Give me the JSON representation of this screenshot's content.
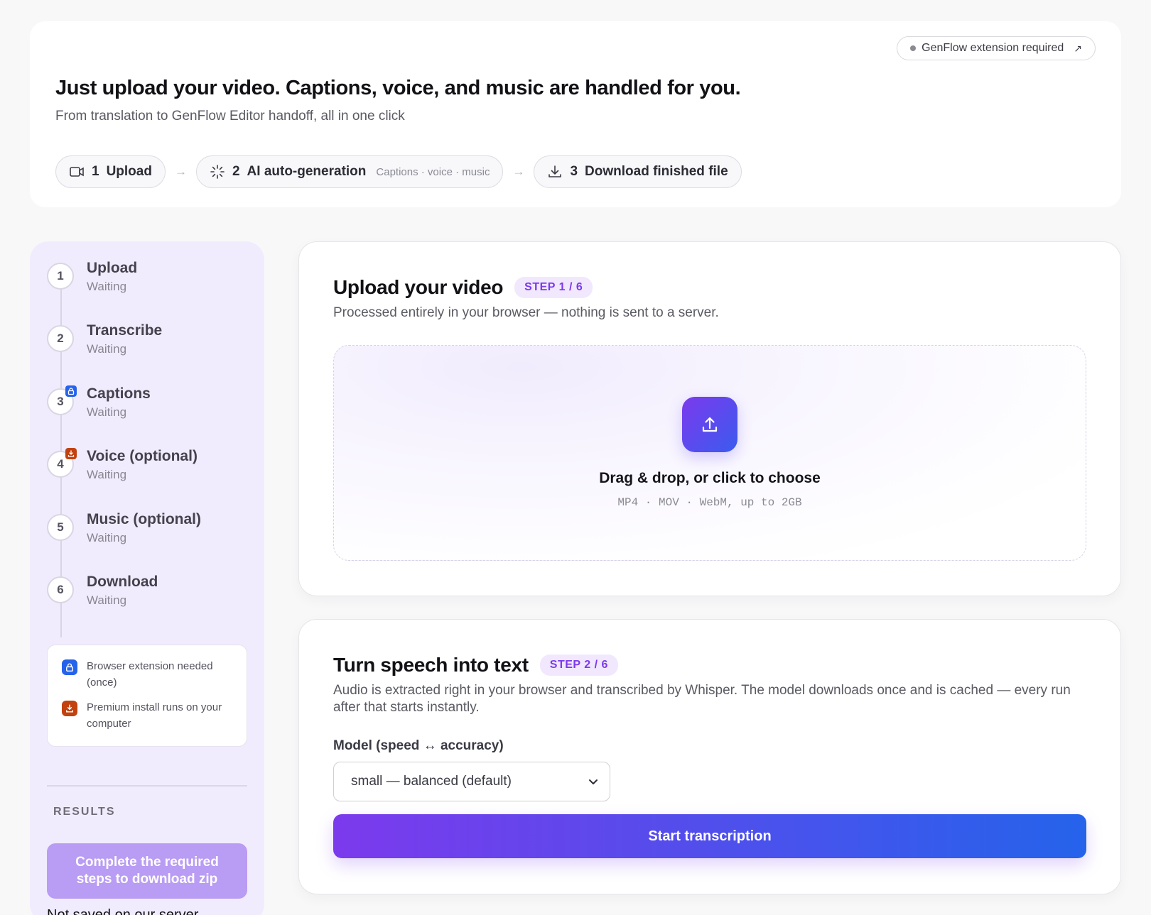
{
  "hero": {
    "extension_pill": "GenFlow extension required",
    "title": "Just upload your video. Captions, voice, and music are handled for you.",
    "subtitle": "From translation to GenFlow Editor handoff, all in one click",
    "flow": [
      {
        "num": "1",
        "label": "Upload",
        "extra": "",
        "icon": "video-camera-icon"
      },
      {
        "num": "2",
        "label": "AI auto-generation",
        "extra": "Captions · voice · music",
        "icon": "spinner-icon"
      },
      {
        "num": "3",
        "label": "Download finished file",
        "extra": "",
        "icon": "download-icon"
      }
    ]
  },
  "sidebar": {
    "steps": [
      {
        "num": "1",
        "title": "Upload",
        "status": "Waiting",
        "badge": ""
      },
      {
        "num": "2",
        "title": "Transcribe",
        "status": "Waiting",
        "badge": ""
      },
      {
        "num": "3",
        "title": "Captions",
        "status": "Waiting",
        "badge": "lock-icon"
      },
      {
        "num": "4",
        "title": "Voice (optional)",
        "status": "Waiting",
        "badge": "download-icon"
      },
      {
        "num": "5",
        "title": "Music (optional)",
        "status": "Waiting",
        "badge": ""
      },
      {
        "num": "6",
        "title": "Download",
        "status": "Waiting",
        "badge": ""
      }
    ],
    "legend": [
      {
        "icon": "lock-icon",
        "text": "Browser extension needed (once)"
      },
      {
        "icon": "download-icon",
        "text": "Premium install runs on your computer"
      }
    ],
    "results_label": "RESULTS",
    "zip_button": "Complete the required steps to download zip",
    "not_saved": "Not saved on our server"
  },
  "upload_card": {
    "title": "Upload your video",
    "step": "STEP 1 / 6",
    "description": "Processed entirely in your browser — nothing is sent to a server.",
    "dropzone_title": "Drag & drop, or click to choose",
    "dropzone_formats": "MP4 · MOV · WebM, up to 2GB"
  },
  "transcribe_card": {
    "title": "Turn speech into text",
    "step": "STEP 2 / 6",
    "description": "Audio is extracted right in your browser and transcribed by Whisper. The model downloads once and is cached — every run after that starts instantly.",
    "model_label": "Model (speed ↔ accuracy)",
    "model_value": "small — balanced (default)",
    "start_button": "Start transcription"
  },
  "colors": {
    "accent_purple": "#7c3aed",
    "accent_blue": "#2563eb",
    "badge_orange": "#c2410c",
    "sidebar_bg": "#f1ecfd"
  }
}
